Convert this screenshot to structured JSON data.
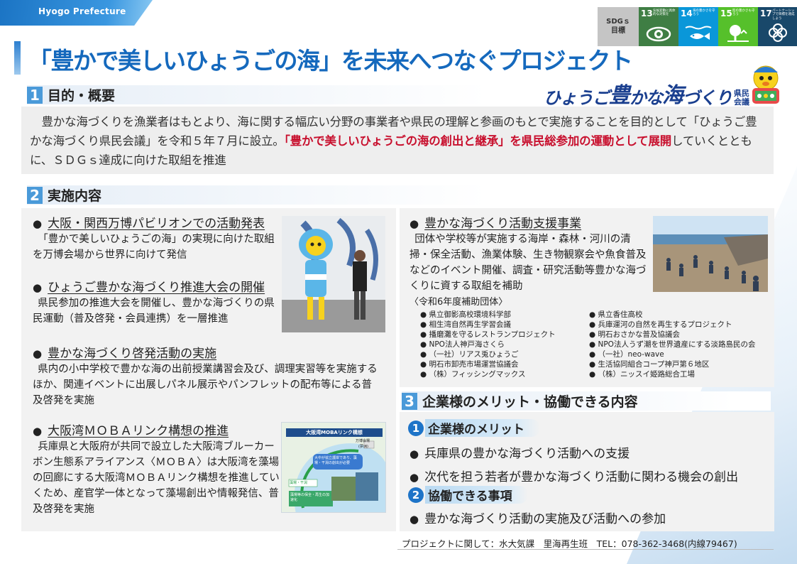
{
  "header": {
    "prefecture": "Hyogo Prefecture",
    "title": "「豊かで美しいひょうごの海」を未来へつなぐプロジェクト"
  },
  "sdgs": {
    "label_line1": "SDGｓ",
    "label_line2": "目標",
    "goals": [
      {
        "num": "13",
        "text": "気候変動に具体的な対策を",
        "color": "#3f7e44",
        "icon": "globe-eye-icon"
      },
      {
        "num": "14",
        "text": "海の豊かさを守ろう",
        "color": "#0a97d9",
        "icon": "fish-icon"
      },
      {
        "num": "15",
        "text": "陸の豊かさも守ろう",
        "color": "#56c02b",
        "icon": "tree-icon"
      },
      {
        "num": "17",
        "text": "パートナーシップで目標を達成しよう",
        "color": "#19486a",
        "icon": "partnership-icon"
      }
    ]
  },
  "logo": {
    "text_a": "ひょうご",
    "text_big": "豊",
    "text_b": "かな",
    "text_big2": "海",
    "text_c": "づくり",
    "sub1": "県民",
    "sub2": "会議"
  },
  "section1": {
    "num": "1",
    "title": "目的・概要",
    "text_a": "豊かな海づくりを漁業者はもとより、海に関する幅広い分野の事業者や県民の理解と参画のもとで実施することを目的として「ひょうご豊かな海づくり県民会議」を令和５年７月に設立。",
    "text_highlight": "「豊かで美しいひょうごの海の創出と継承」を県民総参加の運動として展開",
    "text_b": "していくとともに、ＳＤＧｓ達成に向けた取組を推進"
  },
  "section2": {
    "num": "2",
    "title": "実施内容",
    "bullet": "●",
    "items": [
      {
        "head": "大阪・関西万博パビリオンでの活動発表",
        "body": "「豊かで美しいひょうごの海」の実現に向けた取組を万博会場から世界に向けて発信"
      },
      {
        "head": "ひょうご豊かな海づくり推進大会の開催",
        "body": "県民参加の推進大会を開催し、豊かな海づくりの県民運動（普及啓発・会員連携）を一層推進"
      },
      {
        "head": "豊かな海づくり啓発活動の実施",
        "body": "県内の小中学校で豊かな海の出前授業講習会及び、調理実習等を実施するほか、関連イベントに出展しパネル展示やパンフレットの配布等による普及啓発を実施"
      },
      {
        "head": "大阪湾ＭＯＢＡリンク構想の推進",
        "body": "兵庫県と大阪府が共同で設立した大阪湾ブルーカーボン生態系アライアンス〈ＭＯＢＡ〉は大阪湾を藻場の回廊にする大阪湾ＭＯＢＡリンク構想を推進していくため、産官学一体となって藻場創出や情報発信、普及啓発を実施"
      },
      {
        "head": "豊かな海づくり活動支援事業",
        "body": "団体や学校等が実施する海岸・森林・河川の清掃・保全活動、漁業体験、生き物観察会や魚食普及などのイベント開催、調査・研究活動等豊かな海づくりに資する取組を補助",
        "note": "〈令和6年度補助団体〉"
      }
    ],
    "groups_left": [
      "● 県立御影高校環境科学部",
      "● 相生湾自然再生学習会議",
      "● 播磨灘を守るレストランプロジェクト",
      "● NPO法人神戸海さくら",
      "● （一社）リアス兎ひょうご",
      "● 明石市卸売市場運営協議会",
      "● （株）フィッシングマックス"
    ],
    "groups_right": [
      "● 県立香住高校",
      "● 兵庫運河の自然を再生するプロジェクト",
      "● 明石おさかな普及協議会",
      "● NPO法人うず潮を世界遺産にする淡路島民の会",
      "● （一社）neo-wave",
      "● 生活協同組合コープ神戸第６地区",
      "● （株）ニッスイ姫路総合工場"
    ],
    "map": {
      "title": "大阪湾MOBAリンク構想",
      "tag1": "万博会場",
      "tag1b": "(夢洲)",
      "bubble": "大中が協立護岸であり、藻場・干潟の創出が必要",
      "tag2": "藻場・干潟",
      "tag3": "藻場等の保全・再生の加速化"
    }
  },
  "section3": {
    "num": "3",
    "title": "企業様のメリット・協働できる内容",
    "sub1_num": "1",
    "sub1_label": "企業様のメリット",
    "merits": [
      "兵庫県の豊かな海づくり活動への支援",
      "次代を担う若者が豊かな海づくり活動に関わる機会の創出"
    ],
    "sub2_num": "2",
    "sub2_label": "協働できる事項",
    "collab": [
      "豊かな海づくり活動の実施及び活動への参加"
    ],
    "bullet": "●"
  },
  "footer": {
    "contact": "プロジェクトに関して：水大気課　里海再生班　TEL：078-362-3468(内線79467)"
  }
}
